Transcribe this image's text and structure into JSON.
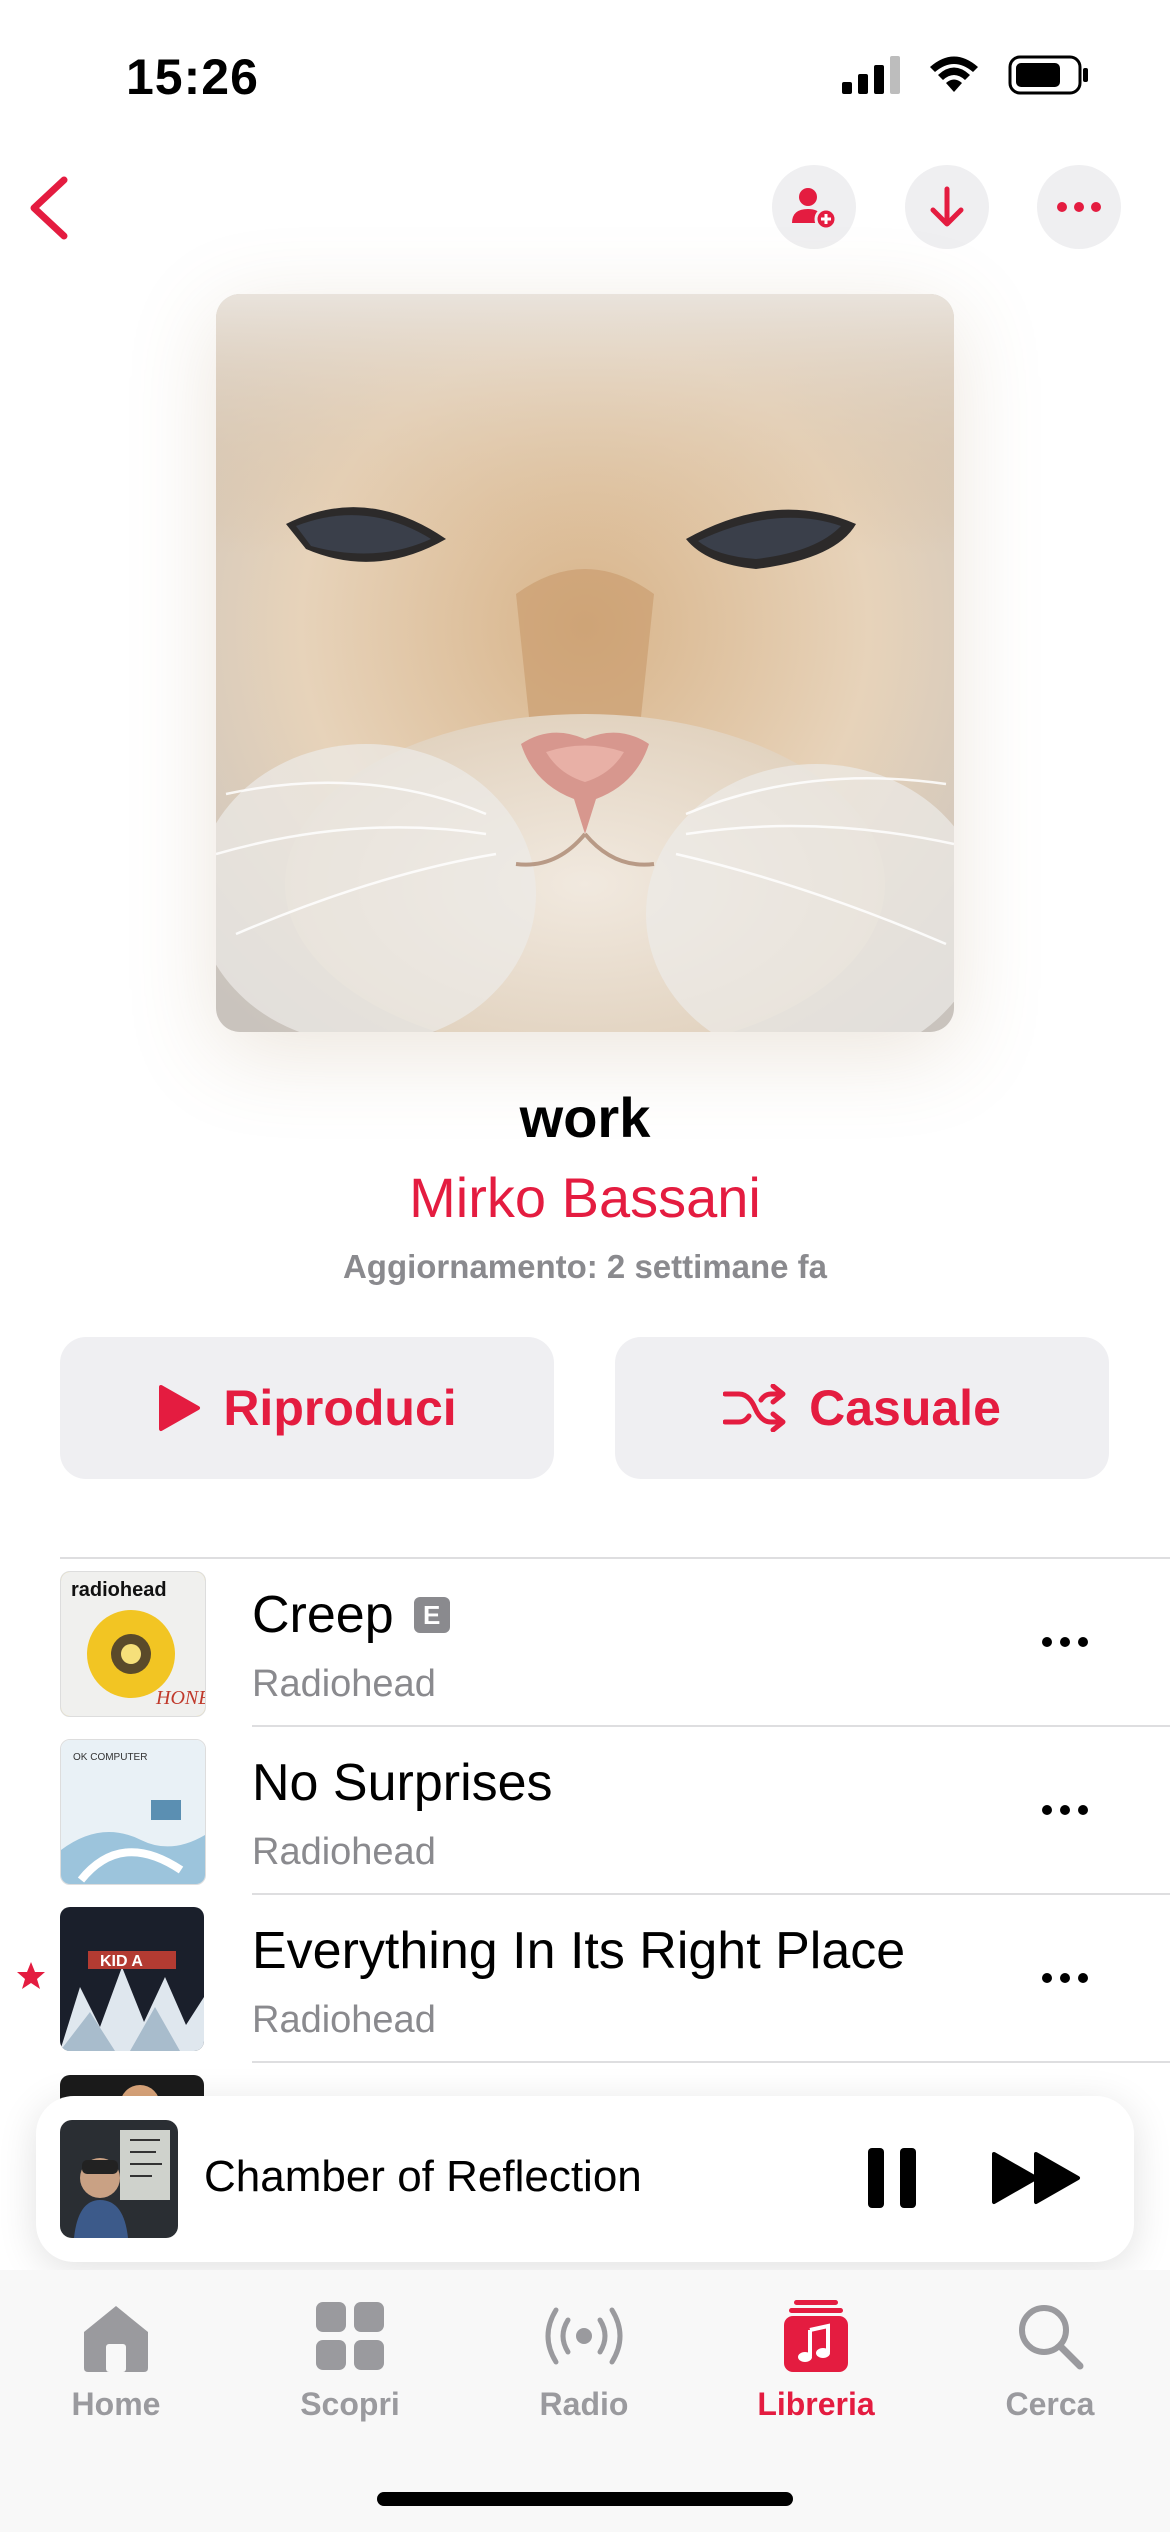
{
  "status_bar": {
    "time": "15:26"
  },
  "playlist": {
    "title": "work",
    "author": "Mirko Bassani",
    "updated": "Aggiornamento: 2 settimane fa"
  },
  "buttons": {
    "play": "Riproduci",
    "shuffle": "Casuale"
  },
  "tracks": [
    {
      "title": "Creep",
      "artist": "Radiohead",
      "explicit": "E",
      "art_text": "radiohead"
    },
    {
      "title": "No Surprises",
      "artist": "Radiohead",
      "art_text": "OK COMPUTER"
    },
    {
      "title": "Everything In Its Right Place",
      "artist": "Radiohead",
      "art_text": "KID A"
    }
  ],
  "now_playing": {
    "title": "Chamber of Reflection"
  },
  "tabs": [
    {
      "label": "Home"
    },
    {
      "label": "Scopri"
    },
    {
      "label": "Radio"
    },
    {
      "label": "Libreria",
      "active": true
    },
    {
      "label": "Cerca"
    }
  ],
  "colors": {
    "accent": "#e41c40",
    "secondary_text": "#8a8a8e",
    "button_bg": "#efeff2"
  }
}
